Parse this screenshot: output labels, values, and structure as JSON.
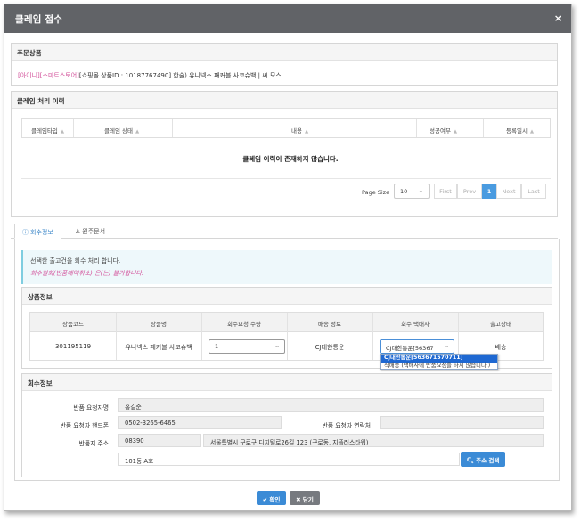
{
  "modal": {
    "title": "클레임 접수",
    "close_glyph": "×"
  },
  "order": {
    "heading": "주문상품",
    "tag1": "[아이니]",
    "tag2": "[스마트스토어]",
    "product_line": "[쇼핑몰 상품ID : 10187767490] 한술) 유니넥스 패커블 사코슈백 | 씨 모스"
  },
  "history": {
    "heading": "클레임 처리 이력",
    "columns": [
      "클레임타입",
      "클레임 상태",
      "내용",
      "성공여부",
      "등록일시"
    ],
    "empty_message": "클레임 이력이 존재하지 않습니다.",
    "page_size_label": "Page Size",
    "page_size_value": "10",
    "pager": {
      "first": "First",
      "prev": "Prev",
      "current": "1",
      "next": "Next",
      "last": "Last"
    }
  },
  "tabs": [
    {
      "label": "회수정보",
      "icon": "info-icon",
      "active": true
    },
    {
      "label": "원주문서",
      "icon": "user-icon",
      "active": false
    }
  ],
  "notice": {
    "line1": "선택한 출고건을 회수 처리 합니다.",
    "line2": "회수철회(반품예약취소) 은(는) 불가합니다."
  },
  "product_info": {
    "heading": "상품정보",
    "columns": [
      "상품코드",
      "상품명",
      "회수요청 수량",
      "배송 정보",
      "회수 택배사",
      "출고상태"
    ],
    "row": {
      "code": "301195119",
      "name": "유니넥스 패커블 사코슈백",
      "qty": "1",
      "delivery": "CJ대한통운",
      "courier_selected": "CJ대한통운[56367",
      "status": "배송"
    },
    "courier_options": [
      "CJ대한통운[563671570711]",
      "직배송 (택배사에 반품요청을 하지 않습니다.)"
    ]
  },
  "return_info": {
    "heading": "회수정보",
    "requester_label": "반품 요청자명",
    "requester_value": "홍길순",
    "phone_label": "반품 요청자 핸드폰",
    "phone_value": "0502-3265-6465",
    "contact_label": "반품 요청자 연락처",
    "contact_value": "",
    "address_label": "반품지 주소",
    "zipcode": "08390",
    "address1": "서울특별시 구로구 디지털로26길 123 (구로동, 지플러스타워)",
    "address2": "101동 A호",
    "search_button": "주소 검색"
  },
  "footer": {
    "ok": "확인",
    "close": "닫기"
  }
}
